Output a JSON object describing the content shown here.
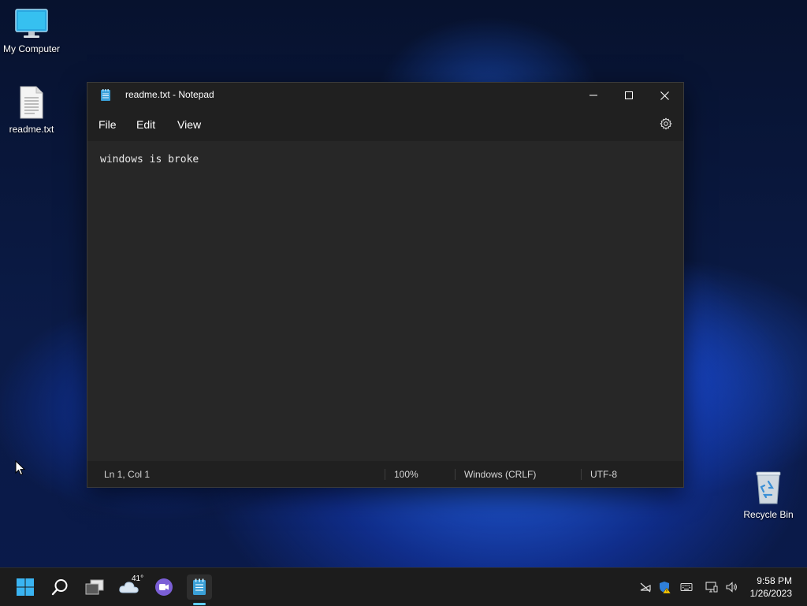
{
  "desktop": {
    "icons": [
      {
        "label": "My Computer",
        "icon": "monitor-icon"
      },
      {
        "label": "readme.txt",
        "icon": "text-file-icon"
      },
      {
        "label": "Recycle Bin",
        "icon": "recycle-bin-icon"
      }
    ]
  },
  "notepad": {
    "title": "readme.txt - Notepad",
    "menu": [
      "File",
      "Edit",
      "View"
    ],
    "content": "windows is broke",
    "status": {
      "position": "Ln 1, Col 1",
      "zoom": "100%",
      "line_ending": "Windows (CRLF)",
      "encoding": "UTF-8"
    }
  },
  "taskbar": {
    "weather_temp": "41°",
    "time": "9:58 PM",
    "date": "1/26/2023"
  },
  "colors": {
    "accent": "#60cdff",
    "window_bg": "#272727",
    "chrome_bg": "#202020"
  }
}
